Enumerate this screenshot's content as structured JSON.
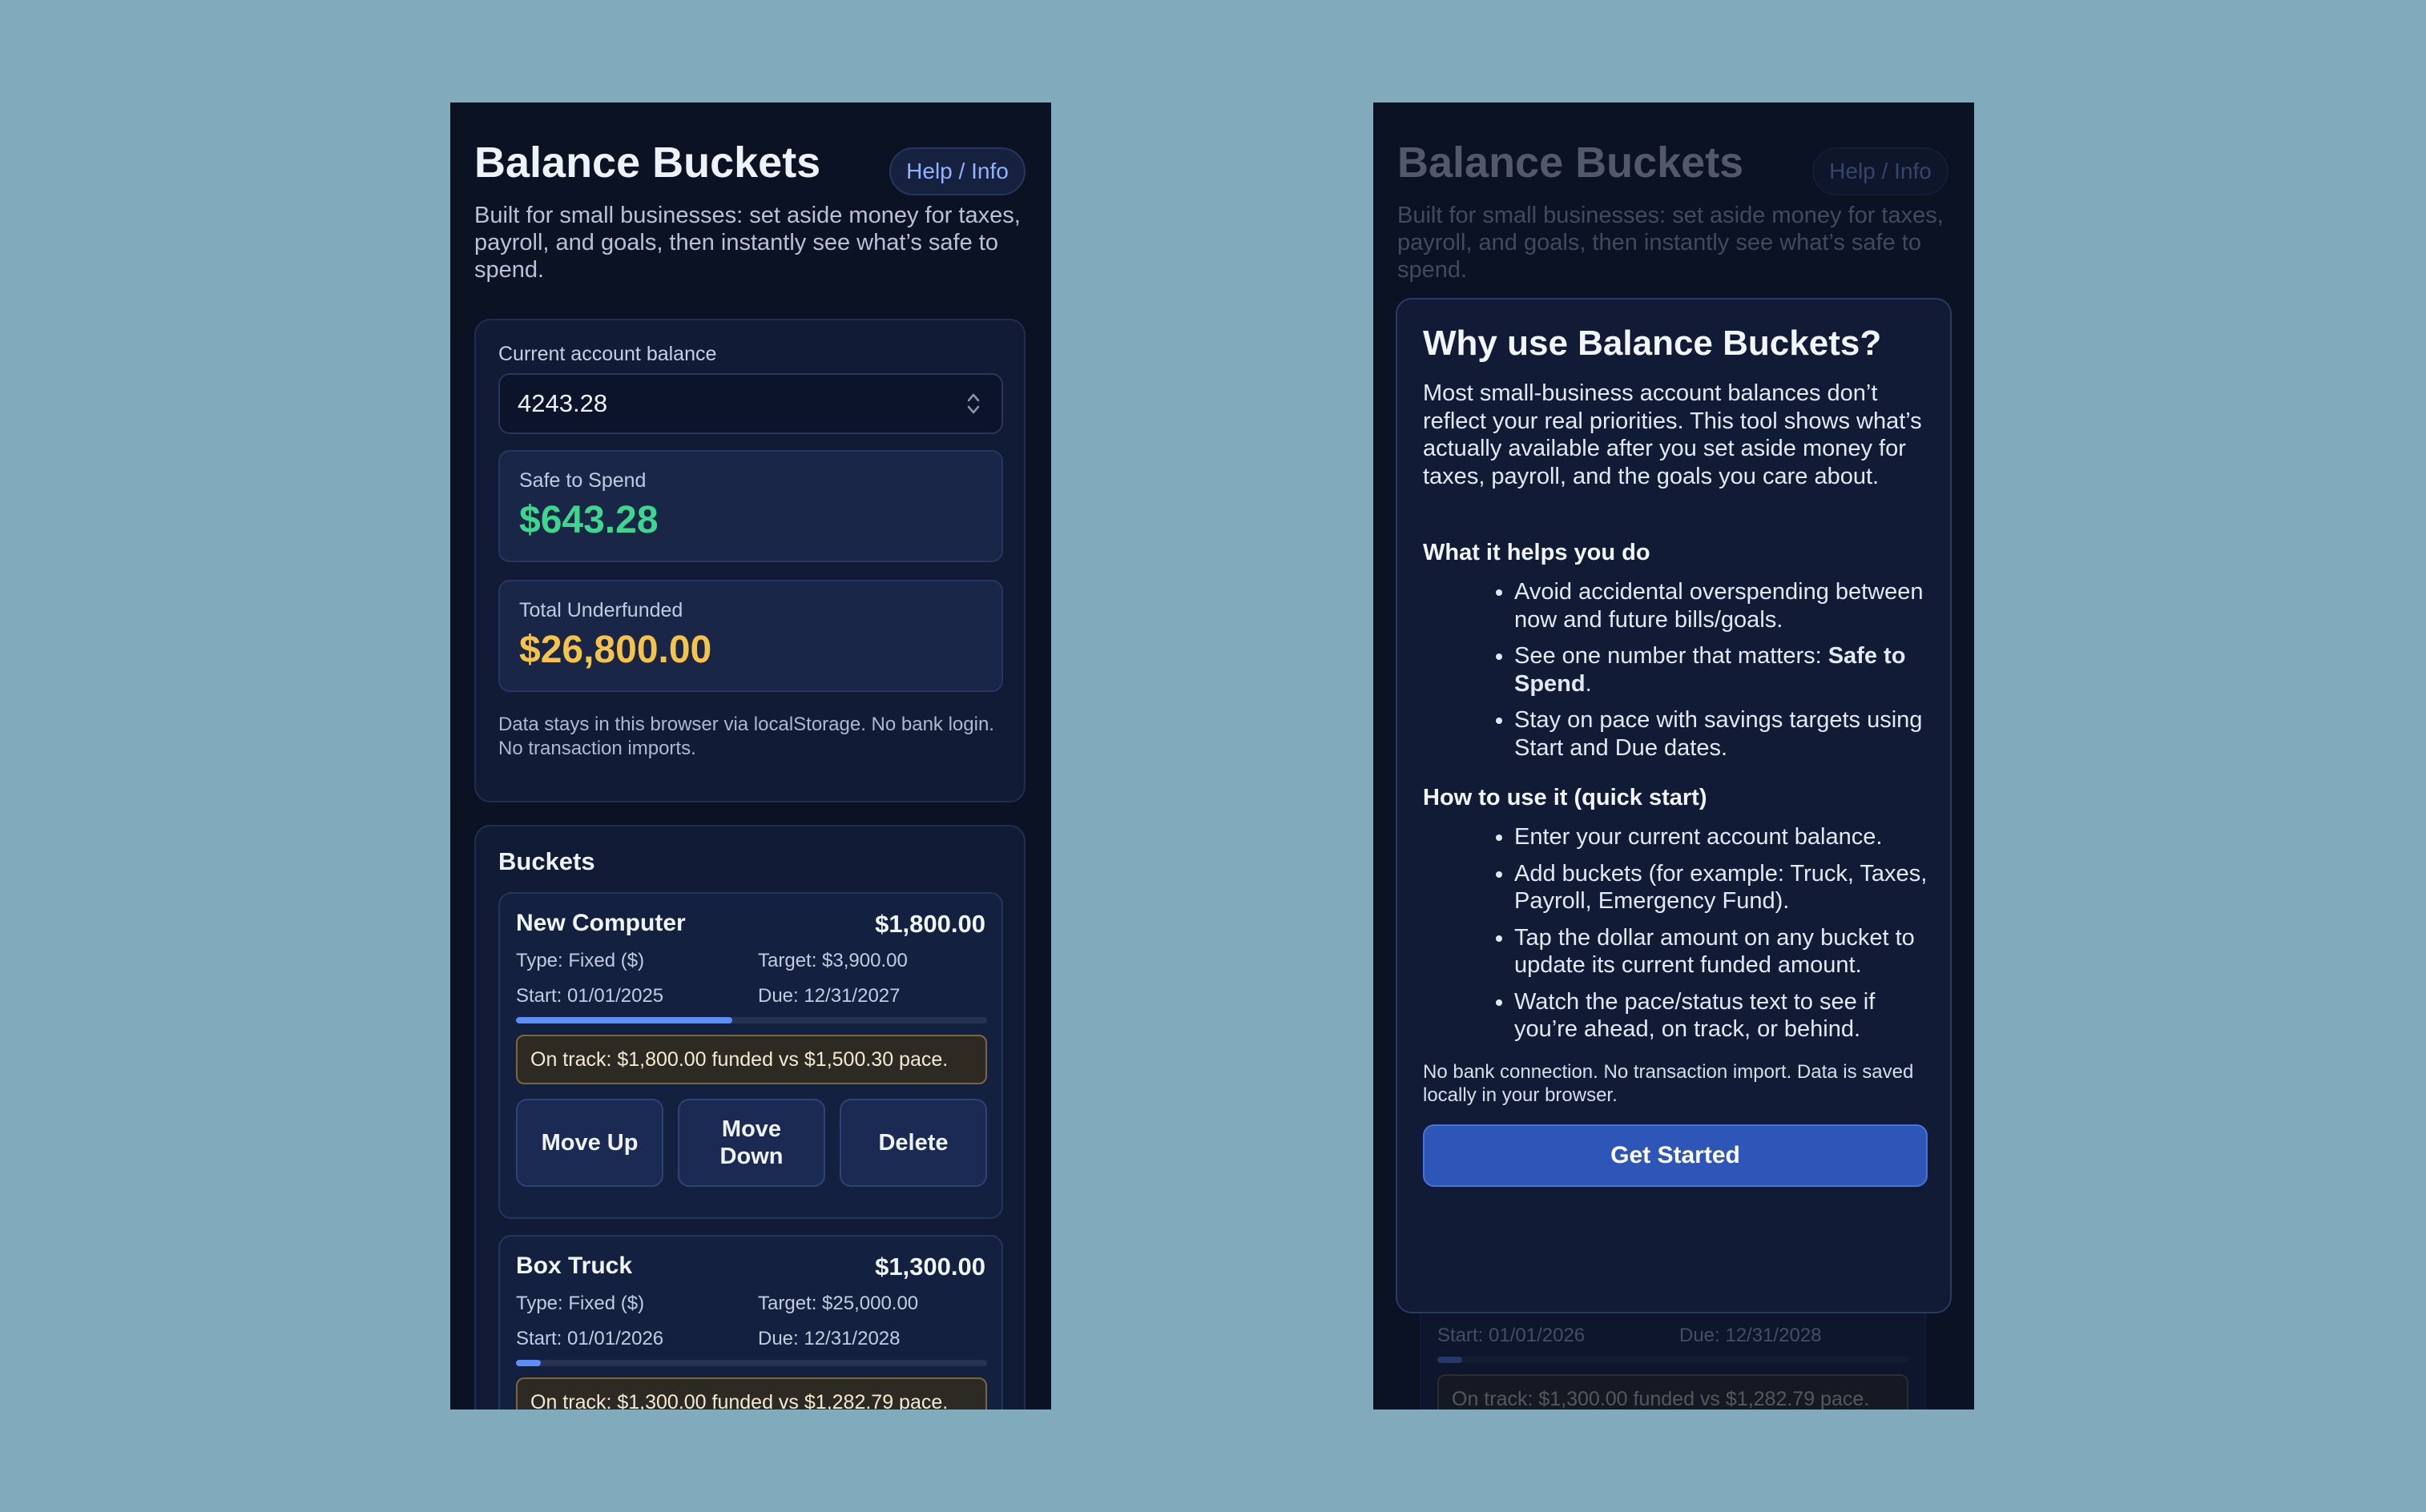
{
  "app": {
    "title": "Balance Buckets",
    "help_label": "Help / Info",
    "tagline": "Built for small businesses: set aside money for taxes, payroll, and goals, then instantly see what’s safe to spend."
  },
  "balance": {
    "label": "Current account balance",
    "value": "4243.28"
  },
  "stats": {
    "safe_label": "Safe to Spend",
    "safe_value": "$643.28",
    "under_label": "Total Underfunded",
    "under_value": "$26,800.00"
  },
  "privacy_note": "Data stays in this browser via localStorage. No bank login. No transaction imports.",
  "buckets": {
    "title": "Buckets",
    "items": [
      {
        "name": "New Computer",
        "amount": "$1,800.00",
        "type": "Type: Fixed ($)",
        "target": "Target: $3,900.00",
        "start": "Start: 01/01/2025",
        "due": "Due: 12/31/2027",
        "progress": 0.46,
        "pace": "On track: $1,800.00 funded vs $1,500.30 pace.",
        "move_up": "Move Up",
        "move_down": "Move Down",
        "delete": "Delete"
      },
      {
        "name": "Box Truck",
        "amount": "$1,300.00",
        "type": "Type: Fixed ($)",
        "target": "Target: $25,000.00",
        "start": "Start: 01/01/2026",
        "due": "Due: 12/31/2028",
        "progress": 0.052,
        "pace": "On track: $1,300.00 funded vs $1,282.79 pace."
      }
    ]
  },
  "modal": {
    "title": "Why use Balance Buckets?",
    "intro": "Most small-business account balances don’t reflect your real priorities. This tool shows what’s actually available after you set aside money for taxes, payroll, and the goals you care about.",
    "what_heading": "What it helps you do",
    "what_items": [
      "Avoid accidental overspending between now and future bills/goals.",
      "See one number that matters: ",
      "Stay on pace with savings targets using Start and Due dates."
    ],
    "what_bold": "Safe to Spend",
    "what_period": ".",
    "how_heading": "How to use it (quick start)",
    "how_items": [
      "Enter your current account balance.",
      "Add buckets (for example: Truck, Taxes, Payroll, Emergency Fund).",
      "Tap the dollar amount on any bucket to update its current funded amount.",
      "Watch the pace/status text to see if you’re ahead, on track, or behind."
    ],
    "note": "No bank connection. No transaction import. Data is saved locally in your browser.",
    "cta": "Get Started"
  },
  "colors": {
    "background": "#82aabd",
    "safe_green": "#3dd68c",
    "underfunded_amber": "#f6c34a",
    "accent_blue": "#5b8ef7",
    "cta_blue": "#2e56b8"
  },
  "icons": {
    "stepper": "up-down-chevron-icon"
  }
}
